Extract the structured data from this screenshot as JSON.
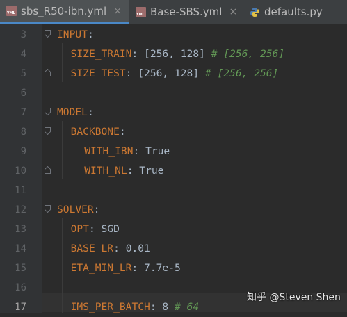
{
  "tabs": [
    {
      "label": "sbs_R50-ibn.yml",
      "icon": "yml-file-icon",
      "icon_text": "YML",
      "active": true,
      "close": "×"
    },
    {
      "label": "Base-SBS.yml",
      "icon": "yml-file-icon",
      "icon_text": "YML",
      "active": false,
      "close": "×"
    },
    {
      "label": "defaults.py",
      "icon": "python-file-icon",
      "active": false,
      "close": ""
    }
  ],
  "lines": [
    {
      "num": "3",
      "indent": 0,
      "key": "INPUT",
      "sep": ":",
      "value": "",
      "comment": ""
    },
    {
      "num": "4",
      "indent": 1,
      "key": "SIZE_TRAIN",
      "sep": ": ",
      "value": "[256, 128] ",
      "comment": "# [256, 256]"
    },
    {
      "num": "5",
      "indent": 1,
      "key": "SIZE_TEST",
      "sep": ": ",
      "value": "[256, 128] ",
      "comment": "# [256, 256]"
    },
    {
      "num": "6",
      "indent": 0,
      "key": "",
      "sep": "",
      "value": "",
      "comment": ""
    },
    {
      "num": "7",
      "indent": 0,
      "key": "MODEL",
      "sep": ":",
      "value": "",
      "comment": ""
    },
    {
      "num": "8",
      "indent": 1,
      "key": "BACKBONE",
      "sep": ":",
      "value": "",
      "comment": ""
    },
    {
      "num": "9",
      "indent": 2,
      "key": "WITH_IBN",
      "sep": ": ",
      "value": "True",
      "comment": ""
    },
    {
      "num": "10",
      "indent": 2,
      "key": "WITH_NL",
      "sep": ": ",
      "value": "True",
      "comment": ""
    },
    {
      "num": "11",
      "indent": 0,
      "key": "",
      "sep": "",
      "value": "",
      "comment": ""
    },
    {
      "num": "12",
      "indent": 0,
      "key": "SOLVER",
      "sep": ":",
      "value": "",
      "comment": ""
    },
    {
      "num": "13",
      "indent": 1,
      "key": "OPT",
      "sep": ": ",
      "value": "SGD",
      "comment": ""
    },
    {
      "num": "14",
      "indent": 1,
      "key": "BASE_LR",
      "sep": ": ",
      "value": "0.01",
      "comment": ""
    },
    {
      "num": "15",
      "indent": 1,
      "key": "ETA_MIN_LR",
      "sep": ": ",
      "value": "7.7e-5",
      "comment": ""
    },
    {
      "num": "16",
      "indent": 0,
      "key": "",
      "sep": "",
      "value": "",
      "comment": ""
    },
    {
      "num": "17",
      "indent": 1,
      "key": "IMS_PER_BATCH",
      "sep": ": ",
      "value": "8 ",
      "comment": "# 64"
    }
  ],
  "current_line": "17",
  "watermark": "知乎 @Steven Shen",
  "colors": {
    "key": "#cc7832",
    "comment": "#629755",
    "value": "#a9b7c6",
    "background": "#2b2b2b",
    "gutter": "#313335",
    "active_tab_underline": "#4a88c7"
  }
}
